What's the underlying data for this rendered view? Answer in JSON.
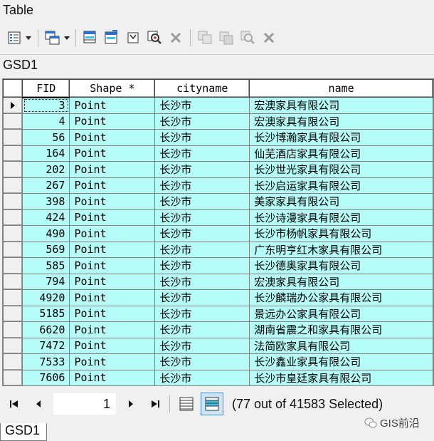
{
  "window": {
    "title": "Table"
  },
  "toolbar": {
    "icons": [
      "table-options-icon",
      "related-tables-icon",
      "select-by-attributes-icon",
      "switch-selection-icon",
      "clear-selection-icon",
      "zoom-to-selected-icon",
      "delete-selected-icon",
      "copy-icon",
      "paste-icon",
      "zoom-icon",
      "delete-icon"
    ]
  },
  "layer": {
    "name": "GSD1"
  },
  "columns": [
    "FID",
    "Shape *",
    "cityname",
    "name"
  ],
  "rows": [
    {
      "fid": "3",
      "shape": "Point",
      "city": "长沙市",
      "name": "宏澳家具有限公司"
    },
    {
      "fid": "4",
      "shape": "Point",
      "city": "长沙市",
      "name": "宏澳家具有限公司"
    },
    {
      "fid": "56",
      "shape": "Point",
      "city": "长沙市",
      "name": "长沙博瀚家具有限公司"
    },
    {
      "fid": "164",
      "shape": "Point",
      "city": "长沙市",
      "name": "仙芜酒店家具有限公司"
    },
    {
      "fid": "202",
      "shape": "Point",
      "city": "长沙市",
      "name": "长沙世光家具有限公司"
    },
    {
      "fid": "267",
      "shape": "Point",
      "city": "长沙市",
      "name": "长沙启运家具有限公司"
    },
    {
      "fid": "398",
      "shape": "Point",
      "city": "长沙市",
      "name": "美家家具有限公司"
    },
    {
      "fid": "424",
      "shape": "Point",
      "city": "长沙市",
      "name": "长沙诗漫家具有限公司"
    },
    {
      "fid": "490",
      "shape": "Point",
      "city": "长沙市",
      "name": "长沙市杨帆家具有限公司"
    },
    {
      "fid": "569",
      "shape": "Point",
      "city": "长沙市",
      "name": "广东明亨红木家具有限公司"
    },
    {
      "fid": "585",
      "shape": "Point",
      "city": "长沙市",
      "name": "长沙德奥家具有限公司"
    },
    {
      "fid": "794",
      "shape": "Point",
      "city": "长沙市",
      "name": "宏澳家具有限公司"
    },
    {
      "fid": "4920",
      "shape": "Point",
      "city": "长沙市",
      "name": "长沙麟瑞办公家具有限公司"
    },
    {
      "fid": "5185",
      "shape": "Point",
      "city": "长沙市",
      "name": "景远办公家具有限公司"
    },
    {
      "fid": "6620",
      "shape": "Point",
      "city": "长沙市",
      "name": "湖南省震之和家具有限公司"
    },
    {
      "fid": "7472",
      "shape": "Point",
      "city": "长沙市",
      "name": "法简欧家具有限公司"
    },
    {
      "fid": "7533",
      "shape": "Point",
      "city": "长沙市",
      "name": "长沙鑫业家具有限公司"
    },
    {
      "fid": "7606",
      "shape": "Point",
      "city": "长沙市",
      "name": "长沙市皇廷家具有限公司"
    }
  ],
  "navigation": {
    "record": "1",
    "status": "(77 out of 41583 Selected)"
  },
  "bottom_tab": {
    "label": "GSD1"
  },
  "watermark": {
    "right": "GIS前沿"
  },
  "colors": {
    "selected_row": "#b6fcf8",
    "active_view": "#cce4f7"
  }
}
